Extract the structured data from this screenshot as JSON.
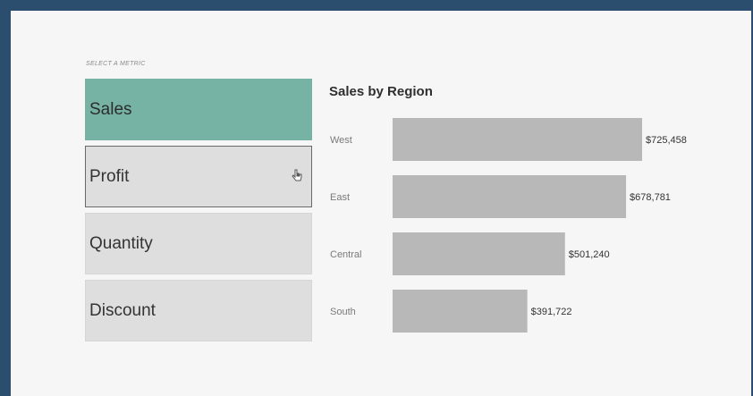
{
  "selector": {
    "caption": "SELECT A METRIC",
    "options": [
      {
        "label": "Sales",
        "selected": true
      },
      {
        "label": "Profit",
        "selected": false
      },
      {
        "label": "Quantity",
        "selected": false
      },
      {
        "label": "Discount",
        "selected": false
      }
    ]
  },
  "colors": {
    "selected": "#76b3a5",
    "bar": "#b8b8b8",
    "background": "#2b4e6e"
  },
  "chart_data": {
    "type": "bar",
    "orientation": "horizontal",
    "title": "Sales by Region",
    "categories": [
      "West",
      "East",
      "Central",
      "South"
    ],
    "values": [
      725458,
      678781,
      501240,
      391722
    ],
    "value_labels": [
      "$725,458",
      "$678,781",
      "$501,240",
      "$391,722"
    ],
    "xlabel": "",
    "ylabel": "",
    "grid": false
  }
}
